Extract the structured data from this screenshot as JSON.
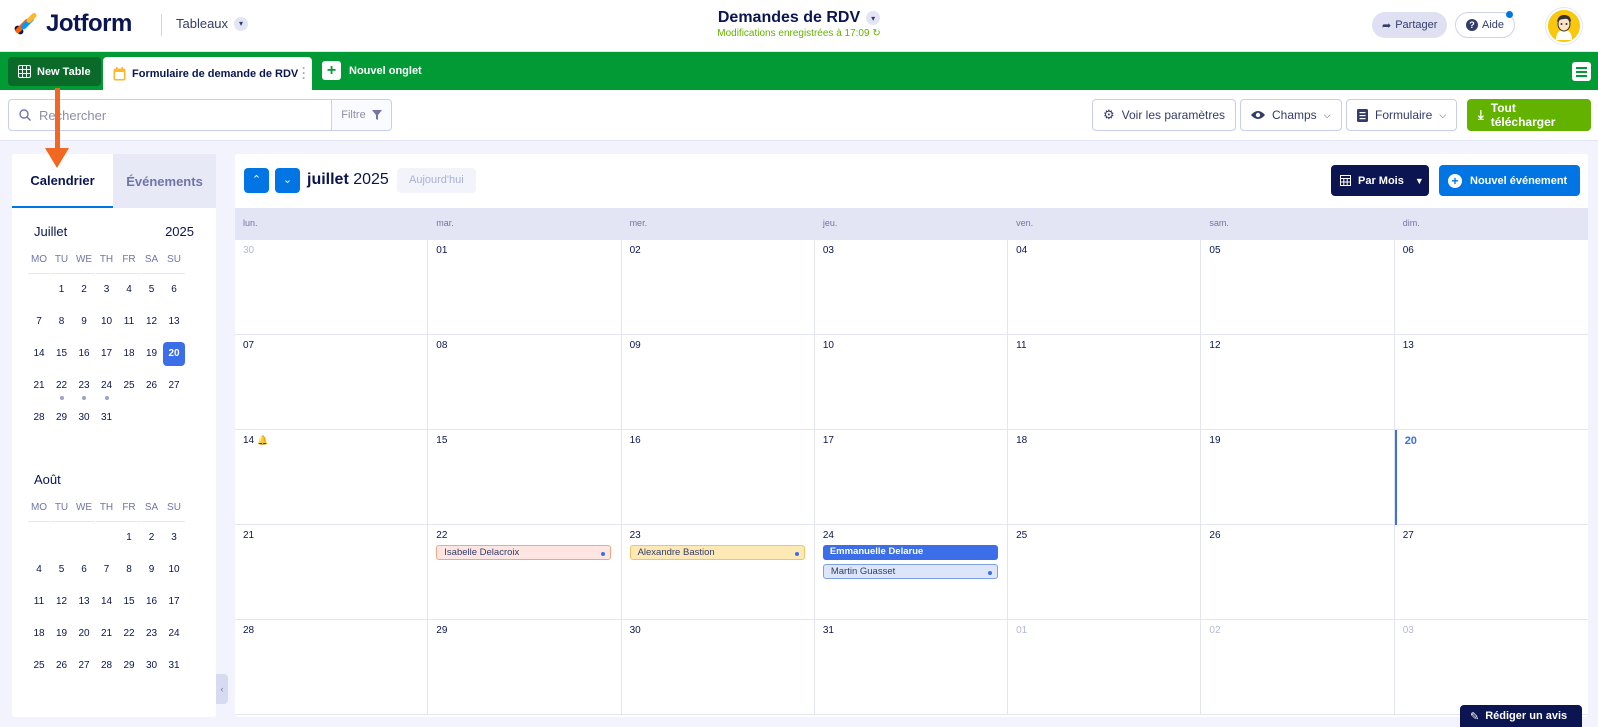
{
  "header": {
    "brand": "Jotform",
    "product": "Tableaux",
    "doc_title": "Demandes de RDV",
    "save_status": "Modifications enregistrées à 17:09",
    "share_label": "Partager",
    "help_label": "Aide"
  },
  "tabs": {
    "new_table": "New Table",
    "form_tab": "Formulaire de demande de RDV",
    "add_tab": "Nouvel onglet"
  },
  "toolbar": {
    "search_placeholder": "Rechercher",
    "filter_label": "Filtre",
    "settings_label": "Voir les paramètres",
    "fields_label": "Champs",
    "form_label": "Formulaire",
    "download_label": "Tout télécharger"
  },
  "sidebar": {
    "tab_calendar": "Calendrier",
    "tab_events": "Événements",
    "weekdays": [
      "MO",
      "TU",
      "WE",
      "TH",
      "FR",
      "SA",
      "SU"
    ],
    "months": [
      {
        "name": "Juillet",
        "year": "2025",
        "offset": 1,
        "days": 31,
        "today": 20,
        "event_days": [
          22,
          23,
          24
        ]
      },
      {
        "name": "Août",
        "year": "",
        "offset": 4,
        "days": 31,
        "today": null,
        "event_days": []
      }
    ]
  },
  "calendar": {
    "month": "juillet",
    "year": "2025",
    "today_label": "Aujourd'hui",
    "view_label": "Par Mois",
    "new_event_label": "Nouvel événement",
    "weekday_labels": [
      "lun.",
      "mar.",
      "mer.",
      "jeu.",
      "ven.",
      "sam.",
      "dim."
    ],
    "weeks": [
      [
        {
          "d": "30",
          "other": true
        },
        {
          "d": "01"
        },
        {
          "d": "02"
        },
        {
          "d": "03"
        },
        {
          "d": "04"
        },
        {
          "d": "05"
        },
        {
          "d": "06"
        }
      ],
      [
        {
          "d": "07"
        },
        {
          "d": "08"
        },
        {
          "d": "09"
        },
        {
          "d": "10"
        },
        {
          "d": "11"
        },
        {
          "d": "12"
        },
        {
          "d": "13"
        }
      ],
      [
        {
          "d": "14",
          "bell": true
        },
        {
          "d": "15"
        },
        {
          "d": "16"
        },
        {
          "d": "17"
        },
        {
          "d": "18"
        },
        {
          "d": "19"
        },
        {
          "d": "20",
          "today": true
        }
      ],
      [
        {
          "d": "21"
        },
        {
          "d": "22",
          "events": [
            {
              "name": "Isabelle Delacroix",
              "style": "peach",
              "dot": true
            }
          ]
        },
        {
          "d": "23",
          "events": [
            {
              "name": "Alexandre Bastion",
              "style": "yellow",
              "dot": true
            }
          ]
        },
        {
          "d": "24",
          "events": [
            {
              "name": "Emmanuelle Delarue",
              "style": "blue",
              "dot": false
            },
            {
              "name": "Martin Guasset",
              "style": "lblue",
              "dot": true
            }
          ]
        },
        {
          "d": "25"
        },
        {
          "d": "26"
        },
        {
          "d": "27"
        }
      ],
      [
        {
          "d": "28"
        },
        {
          "d": "29"
        },
        {
          "d": "30"
        },
        {
          "d": "31"
        },
        {
          "d": "01",
          "other": true
        },
        {
          "d": "02",
          "other": true
        },
        {
          "d": "03",
          "other": true
        }
      ]
    ]
  },
  "review_label": "Rédiger un avis",
  "colors": {
    "accent": "#0075e3",
    "tabbar": "#019a35",
    "download": "#64b200",
    "navy": "#0a1551",
    "today": "#3b6ee8",
    "annotation_arrow": "#f26722"
  }
}
